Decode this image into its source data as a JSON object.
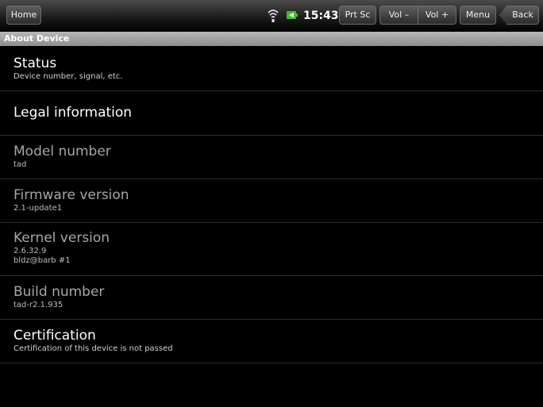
{
  "status_bar": {
    "home_label": "Home",
    "clock": "15:43",
    "prtsc_label": "Prt Sc",
    "vol_down_label": "Vol –",
    "vol_up_label": "Vol +",
    "menu_label": "Menu",
    "back_label": "Back",
    "icons": [
      "wifi-icon",
      "battery-icon"
    ]
  },
  "title": "About Device",
  "items": [
    {
      "title": "Status",
      "subtitle": "Device number, signal, etc."
    },
    {
      "title": "Legal information"
    },
    {
      "title": "Model number",
      "subtitle": "tad"
    },
    {
      "title": "Firmware version",
      "subtitle": "2.1-update1"
    },
    {
      "title": "Kernel version",
      "subtitle_lines": [
        "2.6.32.9",
        "bldz@barb #1"
      ]
    },
    {
      "title": "Build number",
      "subtitle": "tad-r2.1.935"
    },
    {
      "title": "Certification",
      "subtitle": "Certification of this device is not passed"
    }
  ],
  "colors": {
    "background": "#000000",
    "title_bar": "#9f9f9f",
    "battery_accent": "#3fbf2a"
  }
}
